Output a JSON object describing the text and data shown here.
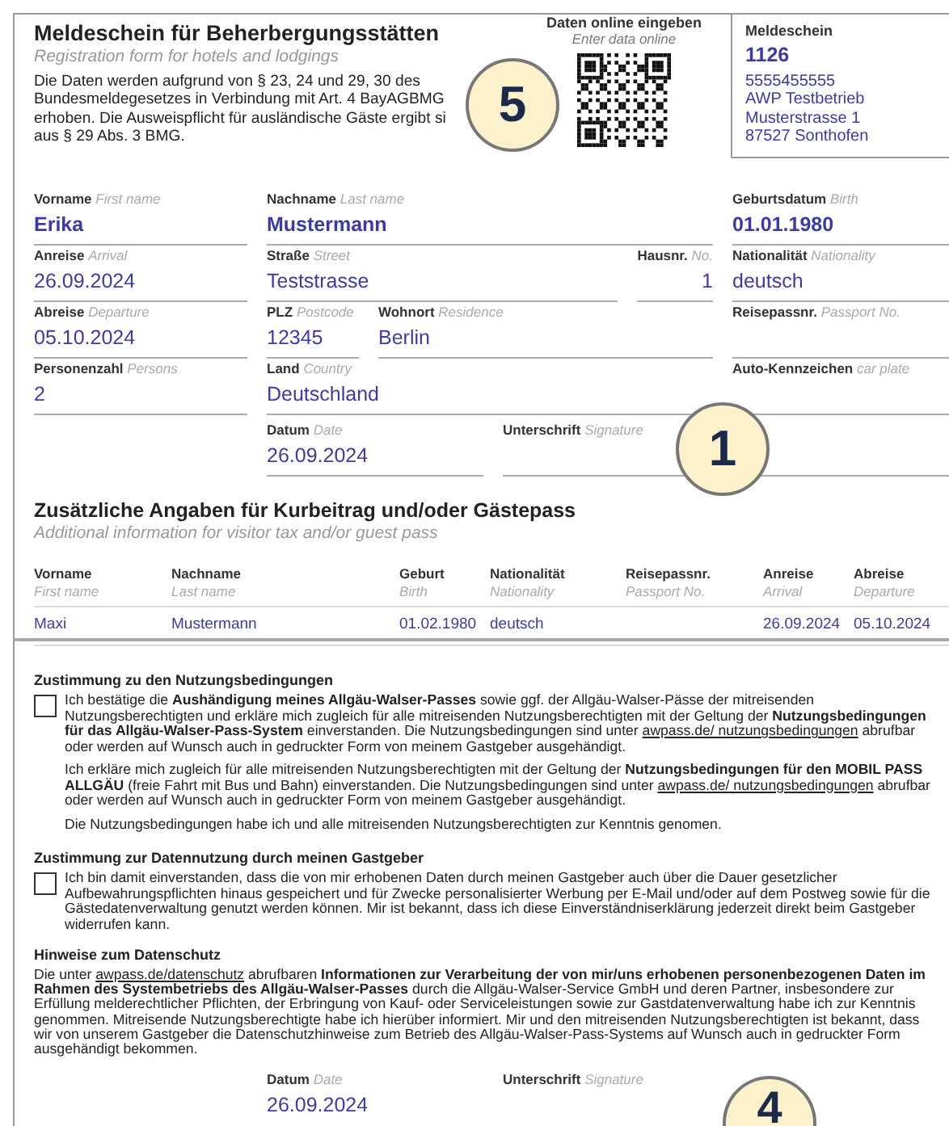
{
  "header": {
    "title": "Meldeschein für Beherbergungsstätten",
    "subtitle": "Registration form for hotels and lodgings",
    "intro_lines": [
      "Die Daten werden aufgrund von § 23, 24 und 29, 30 des",
      "Bundesmeldegesetzes in Verbindung mit Art. 4 BayAGBMG",
      "erhoben. Die Ausweispflicht für ausländische Gäste ergibt si",
      "aus § 29 Abs. 3 BMG."
    ],
    "callout": "5",
    "online": {
      "label": "Daten online eingeben",
      "hint": "Enter data online"
    }
  },
  "certificate": {
    "label": "Meldeschein",
    "number": "1126",
    "lines": [
      "5555455555",
      "AWP Testbetrieb",
      "Musterstrasse 1",
      "87527 Sonthofen"
    ]
  },
  "guest": {
    "first_name": {
      "label": "Vorname",
      "hint": "First name",
      "value": "Erika"
    },
    "last_name": {
      "label": "Nachname",
      "hint": "Last name",
      "value": "Mustermann"
    },
    "birth": {
      "label": "Geburtsdatum",
      "hint": "Birth",
      "value": "01.01.1980"
    },
    "arrival": {
      "label": "Anreise",
      "hint": "Arrival",
      "value": "26.09.2024"
    },
    "street": {
      "label": "Straße",
      "hint": "Street",
      "value": "Teststrasse"
    },
    "house_no": {
      "label": "Hausnr.",
      "hint": "No.",
      "value": "1"
    },
    "nationality": {
      "label": "Nationalität",
      "hint": "Nationality",
      "value": "deutsch"
    },
    "departure": {
      "label": "Abreise",
      "hint": "Departure",
      "value": "05.10.2024"
    },
    "postcode": {
      "label": "PLZ",
      "hint": "Postcode",
      "value": "12345"
    },
    "residence": {
      "label": "Wohnort",
      "hint": "Residence",
      "value": "Berlin"
    },
    "passport_no": {
      "label": "Reisepassnr.",
      "hint": "Passport No."
    },
    "persons": {
      "label": "Personenzahl",
      "hint": "Persons",
      "value": "2"
    },
    "country": {
      "label": "Land",
      "hint": "Country",
      "value": "Deutschland"
    },
    "car_plate": {
      "label": "Auto-Kennzeichen",
      "hint": "car plate"
    },
    "date": {
      "label": "Datum",
      "hint": "Date",
      "value": "26.09.2024"
    },
    "signature": {
      "label": "Unterschrift",
      "hint": "Signature"
    },
    "callout": "1"
  },
  "companions": {
    "title": "Zusätzliche Angaben für Kurbeitrag und/oder Gästepass",
    "subtitle": "Additional information for visitor tax and/or guest pass",
    "columns": [
      {
        "label": "Vorname",
        "hint": "First name"
      },
      {
        "label": "Nachname",
        "hint": "Last name"
      },
      {
        "label": "Geburt",
        "hint": "Birth"
      },
      {
        "label": "Nationalität",
        "hint": "Nationality"
      },
      {
        "label": "Reisepassnr.",
        "hint": "Passport No."
      },
      {
        "label": "Anreise",
        "hint": "Arrival"
      },
      {
        "label": "Abreise",
        "hint": "Departure"
      }
    ],
    "rows": [
      [
        "Maxi",
        "Mustermann",
        "01.02.1980",
        "deutsch",
        null,
        "26.09.2024",
        "05.10.2024"
      ]
    ]
  },
  "consents": [
    {
      "heading": "Zustimmung zu den Nutzungsbedingungen",
      "checked": false,
      "paragraphs": [
        [
          {
            "kind": "text",
            "text": "Ich bestätige die **Aushändigung meines Allgäu-Walser-Passes** sowie ggf. der Allgäu-Walser-Pässe der mitreisenden Nutzungsberechtigten und erkläre mich zugleich für alle mitreisenden Nutzungsberechtigten mit der Geltung der **Nutzungsbedingungen für das Allgäu-Walser-Pass-System** einverstanden. Die Nutzungsbedingungen sind unter "
          },
          {
            "kind": "link",
            "text": "awpass.de/ nutzungsbedingungen"
          },
          {
            "kind": "text",
            "text": " abrufbar oder werden auf Wunsch auch in gedruckter Form von meinem Gastgeber ausgehändigt."
          }
        ],
        [
          {
            "kind": "text",
            "text": "Ich erkläre mich zugleich für alle mitreisenden Nutzungsberechtigten mit der Geltung der **Nutzungsbedingungen für den MOBIL PASS ALLGÄU** (freie Fahrt mit Bus und Bahn) einverstanden. Die Nutzungsbedingungen sind unter "
          },
          {
            "kind": "link",
            "text": "awpass.de/ nutzungsbedingungen"
          },
          {
            "kind": "text",
            "text": " abrufbar oder werden auf Wunsch auch in gedruckter Form von meinem Gastgeber ausgehändigt."
          }
        ],
        [
          {
            "kind": "text",
            "text": "Die Nutzungsbedingungen habe ich und alle mitreisenden Nutzungsberechtigten zur Kenntnis genomen."
          }
        ]
      ]
    },
    {
      "heading": "Zustimmung zur Datennutzung durch meinen Gastgeber",
      "checked": false,
      "paragraphs": [
        [
          {
            "kind": "text",
            "text": "Ich bin damit einverstanden, dass die von mir erhobenen Daten durch meinen Gastgeber auch über die Dauer gesetzlicher Aufbewahrungspflichten hinaus gespeichert und für Zwecke personalisierter Werbung per E-Mail und/oder auf dem Postweg sowie für die Gästedatenverwaltung genutzt werden können. Mir ist bekannt, dass ich diese Einverständniserklärung jederzeit direkt beim Gastgeber widerrufen kann."
          }
        ]
      ]
    }
  ],
  "privacy": {
    "heading": "Hinweise zum Datenschutz",
    "parts": [
      {
        "kind": "text",
        "text": "Die unter "
      },
      {
        "kind": "link",
        "text": "awpass.de/datenschutz"
      },
      {
        "kind": "text",
        "text": " abrufbaren **Informationen zur Verarbeitung der von mir/uns erhobenen personenbezogenen Daten im Rahmen des Systembetriebs des Allgäu-Walser-Passes** durch die Allgäu-Walser-Service GmbH und deren Partner, insbesondere zur Erfüllung melderechtlicher Pflichten, der Erbringung von Kauf- oder Serviceleistungen sowie zur Gastdatenverwaltung habe ich zur Kenntnis genommen. Mitreisende Nutzungsberechtigte habe ich hierüber informiert. Mir und den mitreisenden Nutzungsberechtigten ist bekannt, dass wir von unserem Gastgeber die Datenschutzhinweise zum Betrieb des Allgäu-Walser-Pass-Systems auf Wunsch auch in gedruckter Form ausgehändigt bekommen."
      }
    ]
  },
  "final_signature": {
    "date": {
      "label": "Datum",
      "hint": "Date",
      "value": "26.09.2024"
    },
    "signature": {
      "label": "Unterschrift",
      "hint": "Signature"
    },
    "callout": "4"
  }
}
